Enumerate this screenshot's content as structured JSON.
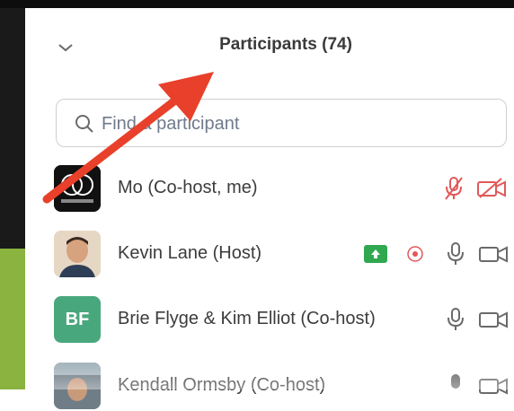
{
  "panel": {
    "title": "Participants (74)"
  },
  "search": {
    "placeholder": "Find a participant"
  },
  "participants": [
    {
      "name": "Mo (Co-host, me)",
      "avatar": "logo"
    },
    {
      "name": "Kevin Lane (Host)",
      "avatar": "photo"
    },
    {
      "name": "Brie Flyge & Kim Elliot (Co-host)",
      "avatar": "initials",
      "initials": "BF"
    },
    {
      "name": "Kendall Ormsby (Co-host)",
      "avatar": "photo"
    }
  ],
  "colors": {
    "muted": "#e0585a",
    "share_badge": "#2fa84f",
    "initials_avatar": "#49a77e",
    "annotation_arrow": "#e8402a"
  },
  "icons": {
    "collapse": "chevron-down-icon",
    "search": "search-icon",
    "mic": "microphone-icon",
    "mic_muted": "microphone-muted-icon",
    "video": "video-camera-icon",
    "video_off": "video-off-icon",
    "share": "screen-share-icon",
    "record": "record-icon"
  }
}
